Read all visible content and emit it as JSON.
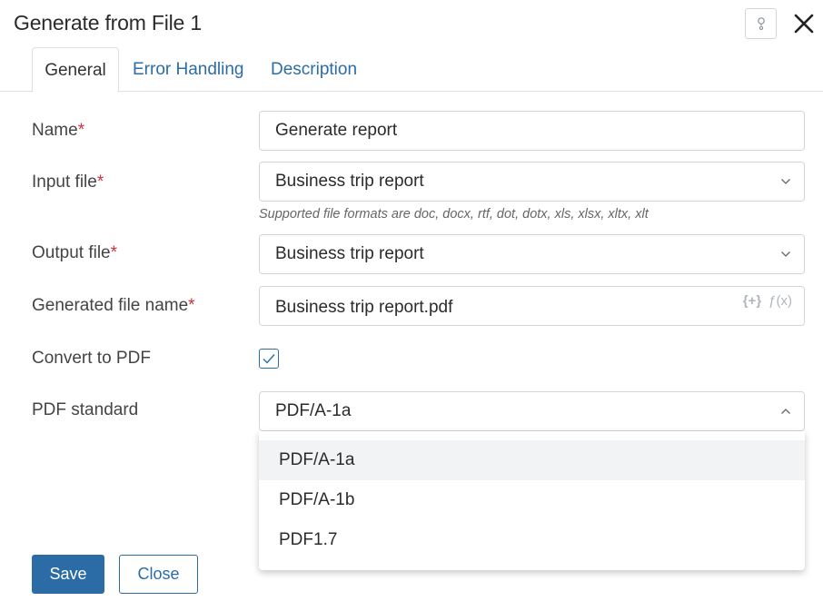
{
  "dialog": {
    "title": "Generate from File 1",
    "help_icon": "question-icon",
    "close_icon": "close-icon"
  },
  "tabs": [
    {
      "label": "General",
      "active": true
    },
    {
      "label": "Error Handling",
      "active": false
    },
    {
      "label": "Description",
      "active": false
    }
  ],
  "form": {
    "name": {
      "label": "Name",
      "required_mark": "*",
      "value": "Generate report"
    },
    "input_file": {
      "label": "Input file",
      "required_mark": "*",
      "value": "Business trip report",
      "hint": "Supported file formats are doc, docx, rtf, dot, dotx, xls, xlsx, xltx, xlt"
    },
    "output_file": {
      "label": "Output file",
      "required_mark": "*",
      "value": "Business trip report"
    },
    "generated_file_name": {
      "label": "Generated file name",
      "required_mark": "*",
      "value": "Business trip report.pdf",
      "variable_icon": "{+}",
      "function_icon": "ƒ(x)"
    },
    "convert_to_pdf": {
      "label": "Convert to PDF",
      "checked": true
    },
    "pdf_standard": {
      "label": "PDF standard",
      "value": "PDF/A-1a",
      "options": [
        "PDF/A-1a",
        "PDF/A-1b",
        "PDF1.7"
      ]
    }
  },
  "buttons": {
    "save": "Save",
    "close": "Close"
  },
  "colors": {
    "accent": "#2c6ca6",
    "required": "#d0313c"
  }
}
